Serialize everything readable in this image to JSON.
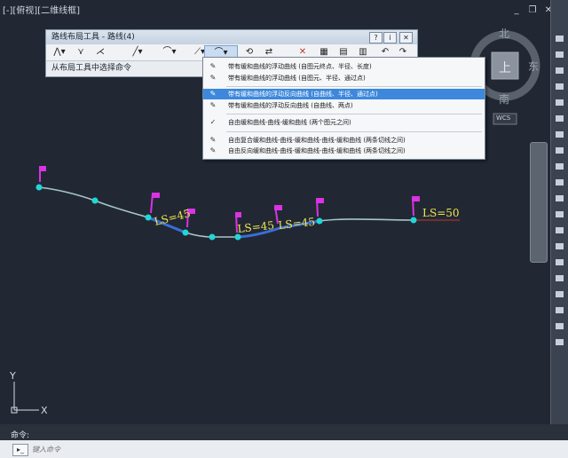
{
  "viewport_label": "[-][俯视][二维线框]",
  "window_controls": [
    "_",
    "❐",
    "✕"
  ],
  "viewcube": {
    "north": "北",
    "east": "东",
    "south": "南",
    "top_face": "上",
    "wcs": "WCS"
  },
  "palette": {
    "title": "路线布局工具 - 路线(4)",
    "prompt": "从布局工具中选择命令",
    "title_buttons": [
      "?",
      "i",
      "✕"
    ]
  },
  "dropdown": {
    "items": [
      {
        "icon": "✎",
        "label": "带有缓和曲线的浮动曲线 (自图元终点、半径、长度)"
      },
      {
        "icon": "✎",
        "label": "带有缓和曲线的浮动曲线 (自图元、半径、通过点)"
      },
      {
        "icon": "✎",
        "label": "带有缓和曲线的浮动反向曲线 (自曲线、半径、通过点)"
      },
      {
        "icon": "✎",
        "label": "带有缓和曲线的浮动反向曲线 (自曲线、两点)"
      },
      {
        "icon": "✓",
        "label": "自由缓和曲线-曲线-缓和曲线 (两个图元之间)"
      },
      {
        "icon": "✎",
        "label": "自由复合缓和曲线-曲线-缓和曲线-曲线-缓和曲线 (两条切线之间)"
      },
      {
        "icon": "✎",
        "label": "自由反向缓和曲线-曲线-缓和曲线-曲线-缓和曲线 (两条切线之间)"
      }
    ],
    "highlighted_index": 2
  },
  "drawing": {
    "labels": [
      "LS=45",
      "LS=45",
      "LS=45",
      "LS=50"
    ]
  },
  "ucs": {
    "x": "X",
    "y": "Y"
  },
  "command": {
    "history_label": "命令:",
    "placeholder": "键入命令",
    "icon": "▸_"
  },
  "colors": {
    "highlight": "#3d88dc",
    "curve": "#3a6ed8",
    "label": "#f2e650",
    "marker": "#d933e3",
    "node": "#22d6d6"
  }
}
